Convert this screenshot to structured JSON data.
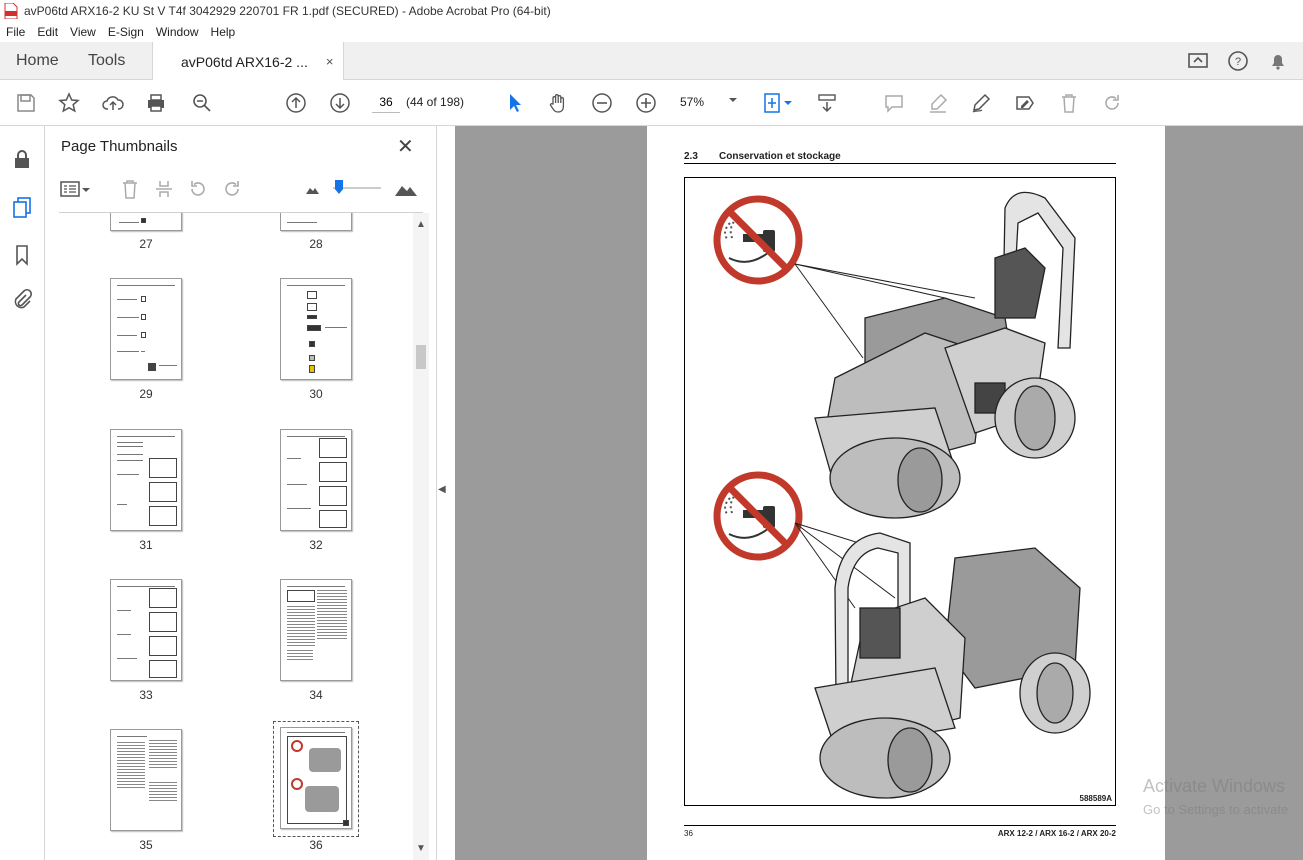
{
  "window": {
    "title": "avP06td ARX16-2 KU St V T4f 3042929 220701 FR 1.pdf (SECURED) - Adobe Acrobat Pro (64-bit)"
  },
  "menu": [
    "File",
    "Edit",
    "View",
    "E-Sign",
    "Window",
    "Help"
  ],
  "tabs": {
    "home": "Home",
    "tools": "Tools",
    "document": "avP06td ARX16-2 ...",
    "close": "×"
  },
  "toolbar": {
    "page_number": "36",
    "page_count": "(44 of 198)",
    "zoom": "57%"
  },
  "panel": {
    "title": "Page Thumbnails",
    "close": "✕",
    "thumbnails": [
      {
        "label": "27"
      },
      {
        "label": "28"
      },
      {
        "label": "29"
      },
      {
        "label": "30"
      },
      {
        "label": "31"
      },
      {
        "label": "32"
      },
      {
        "label": "33"
      },
      {
        "label": "34"
      },
      {
        "label": "35"
      },
      {
        "label": "36",
        "selected": true
      }
    ]
  },
  "document": {
    "section_number": "2.3",
    "section_title": "Conservation et stockage",
    "figure_code": "588589A",
    "page_number": "36",
    "models": "ARX 12-2 / ARX 16-2 / ARX 20-2"
  },
  "watermark": {
    "line1": "Activate Windows",
    "line2": "Go to Settings to activate"
  },
  "colors": {
    "prohibition_red": "#c0392b",
    "select_blue": "#1473e6",
    "viewer_bg": "#9b9b9b"
  }
}
